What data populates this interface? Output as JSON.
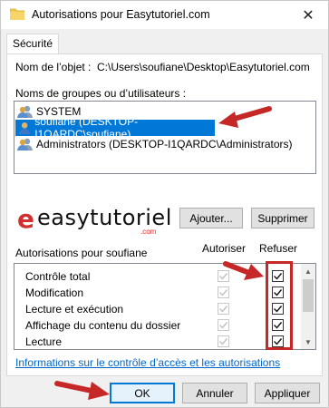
{
  "window": {
    "title": "Autorisations pour Easytutoriel.com",
    "close_glyph": "✕"
  },
  "tabs": [
    {
      "label": "Sécurité"
    }
  ],
  "object": {
    "label": "Nom de l’objet :",
    "value": "C:\\Users\\soufiane\\Desktop\\Easytutoriel.com"
  },
  "groups": {
    "label": "Noms de groupes ou d’utilisateurs :",
    "items": [
      {
        "name": "SYSTEM",
        "icon": "users-group-icon",
        "selected": false
      },
      {
        "name": "soufiane (DESKTOP-I1QARDC\\soufiane)",
        "icon": "user-icon",
        "selected": true
      },
      {
        "name": "Administrators (DESKTOP-I1QARDC\\Administrators)",
        "icon": "users-group-icon",
        "selected": false
      }
    ]
  },
  "logo": {
    "e": "e",
    "word": "easytutoriel",
    "dotcom": ".com"
  },
  "buttons": {
    "add": "Ajouter...",
    "remove": "Supprimer",
    "ok": "OK",
    "cancel": "Annuler",
    "apply": "Appliquer"
  },
  "permissions": {
    "label": "Autorisations pour soufiane",
    "allow_header": "Autoriser",
    "deny_header": "Refuser",
    "rows": [
      {
        "name": "Contrôle total",
        "allow": true,
        "allow_disabled": true,
        "deny": true
      },
      {
        "name": "Modification",
        "allow": true,
        "allow_disabled": true,
        "deny": true
      },
      {
        "name": "Lecture et exécution",
        "allow": true,
        "allow_disabled": true,
        "deny": true
      },
      {
        "name": "Affichage du contenu du dossier",
        "allow": true,
        "allow_disabled": true,
        "deny": true
      },
      {
        "name": "Lecture",
        "allow": true,
        "allow_disabled": true,
        "deny": true
      }
    ]
  },
  "link": {
    "text": "Informations sur le contrôle d’accès et les autorisations"
  },
  "colors": {
    "accent": "#0078d7",
    "annotation_red": "#c62828",
    "link": "#0066cc"
  }
}
